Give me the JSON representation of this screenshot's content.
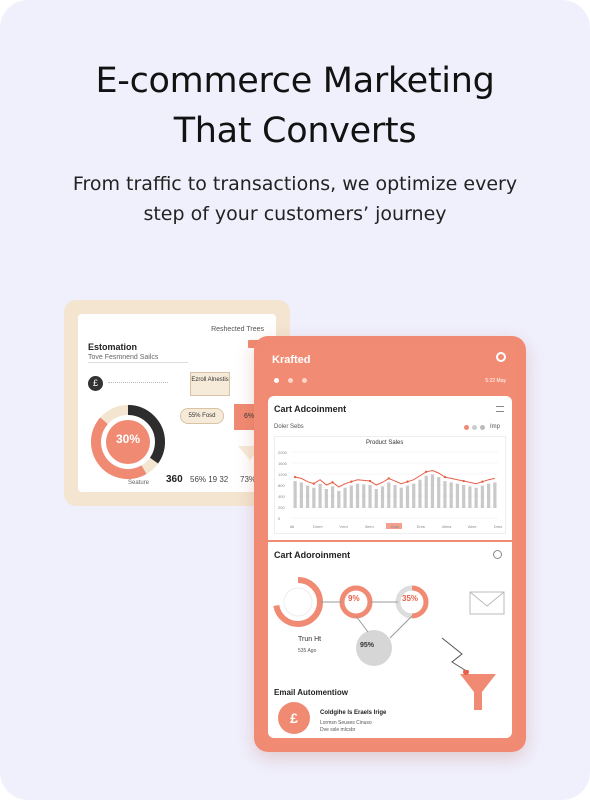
{
  "hero": {
    "title_line1": "E-commerce Marketing",
    "title_line2": "That Converts",
    "subtitle_line1": "From traffic to transactions, we optimize every",
    "subtitle_line2": "step of your customers’ journey"
  },
  "back_card": {
    "corner_label": "Reshected Trees",
    "title": "Estomation",
    "subtitle": "Tove Fesmnend Sailcs",
    "badge_text": "Ezroll Alnestis",
    "pill_text": "55% Fosd",
    "donut_value": "30%",
    "arrow_box": "6%",
    "footer_label": "Seature",
    "footer_value": "360",
    "footer_stats": "56% 19 32",
    "footer_pct": "73% 7%"
  },
  "tablet": {
    "brand": "Krafted",
    "status": "5:22 May",
    "section1_title": "Cart Adcoinment",
    "filter_label": "Doler Sebs",
    "filter_right": "Imp",
    "chart_title": "Product Sales",
    "section2_title": "Cart Adoroinment",
    "pct_small": "9%",
    "pct_mid": "35%",
    "pct_grey": "95%",
    "side_label": "Trun Ht",
    "side_sub": "535 Ago",
    "email_title": "Email Automentiow",
    "pound_symbol": "£",
    "email_item_title": "Coldgihe ls Eraels Irige",
    "email_item_sub": "Lormsn Seuses Cinuso",
    "email_item_sub2": "Dve ssle mlcsbr"
  },
  "chart_data": {
    "type": "line",
    "title": "Product Sales",
    "y_ticks": [
      "2000",
      "1600",
      "1200",
      "800",
      "400",
      "200",
      "0"
    ],
    "x_ticks": [
      "d6",
      "Dmm",
      "Vmd",
      "3mm",
      "Gmn",
      "Dms",
      "40ms",
      "Abre",
      "Dms"
    ],
    "values": [
      62,
      60,
      55,
      52,
      58,
      50,
      54,
      47,
      52,
      55,
      58,
      57,
      56,
      50,
      54,
      60,
      56,
      52,
      55,
      58,
      64,
      70,
      72,
      68,
      62,
      60,
      58,
      56,
      54,
      52,
      55,
      58,
      60
    ],
    "ylim": [
      0,
      100
    ],
    "colors": {
      "line": "#e85f49",
      "bars": "#c9c9c9"
    }
  }
}
